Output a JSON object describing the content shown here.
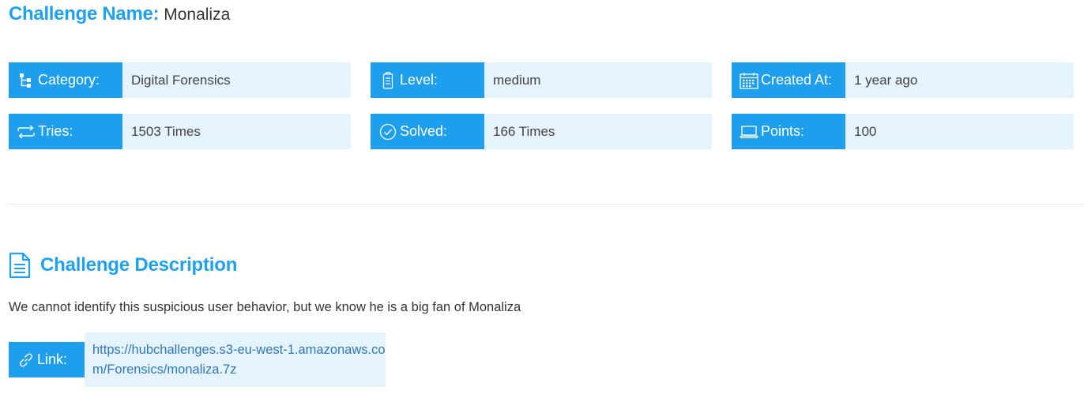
{
  "title": {
    "label": "Challenge Name:",
    "value": "Monaliza"
  },
  "info": {
    "category": {
      "label": "Category:",
      "value": "Digital Forensics",
      "icon": "hierarchy-icon"
    },
    "level": {
      "label": "Level:",
      "value": "medium",
      "icon": "battery-icon"
    },
    "created": {
      "label": "Created At:",
      "value": "1 year ago",
      "icon": "calendar-icon"
    },
    "tries": {
      "label": "Tries:",
      "value": "1503 Times",
      "icon": "repeat-icon"
    },
    "solved": {
      "label": "Solved:",
      "value": "166 Times",
      "icon": "check-circle-icon"
    },
    "points": {
      "label": "Points:",
      "value": "100",
      "icon": "laptop-icon"
    }
  },
  "description": {
    "heading": "Challenge Description",
    "icon": "document-icon",
    "text": "We cannot identify this suspicious user behavior, but we know he is a big fan of Monaliza"
  },
  "link": {
    "label": "Link:",
    "icon": "link-icon",
    "url": "https://hubchallenges.s3-eu-west-1.amazonaws.com/Forensics/monaliza.7z"
  },
  "colors": {
    "accent": "#1d9fee",
    "heading": "#1da1f2",
    "card_bg": "#e5f3fd",
    "link": "#2f78b8"
  }
}
